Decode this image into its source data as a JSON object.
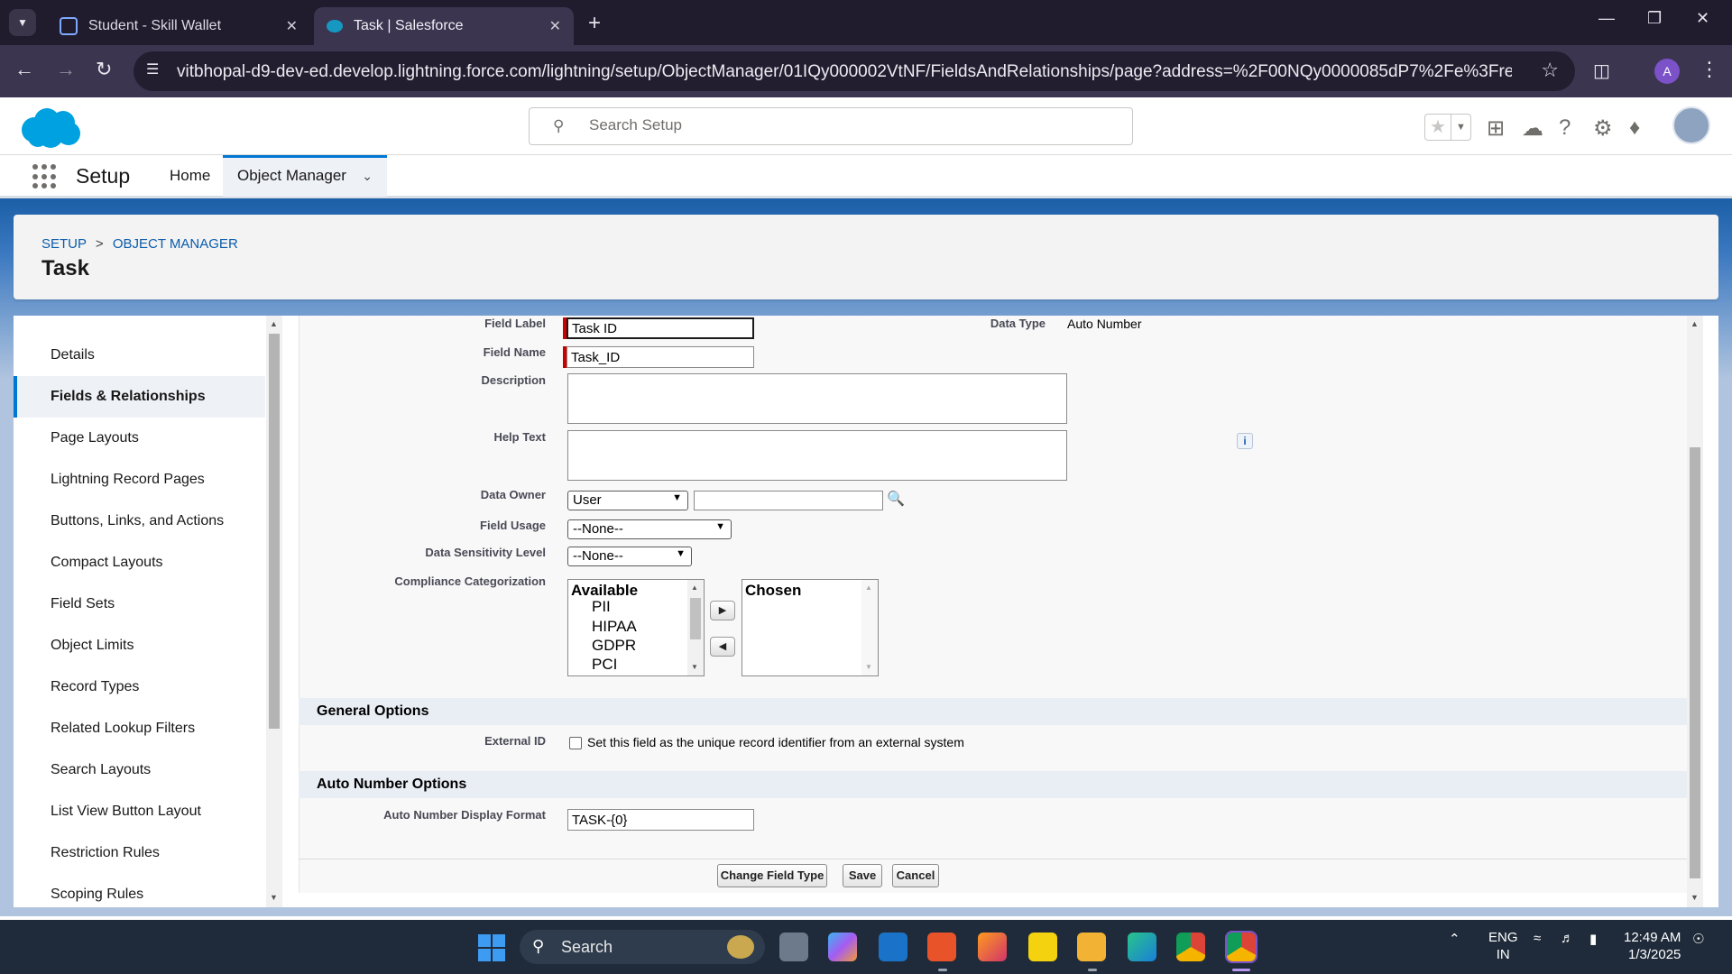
{
  "browser": {
    "tabs": [
      {
        "title": "Student - Skill Wallet"
      },
      {
        "title": "Task | Salesforce"
      }
    ],
    "url": "vitbhopal-d9-dev-ed.develop.lightning.force.com/lightning/setup/ObjectManager/01IQy000002VtNF/FieldsAndRelationships/page?address=%2F00NQy0000085dP7%2Fe%3FretURL%3D%252F...",
    "profile_initial": "A"
  },
  "header": {
    "search_placeholder": "Search Setup"
  },
  "nav": {
    "app_name": "Setup",
    "home": "Home",
    "object_manager": "Object Manager"
  },
  "page": {
    "breadcrumb_setup": "SETUP",
    "breadcrumb_sep": ">",
    "breadcrumb_om": "OBJECT MANAGER",
    "title": "Task"
  },
  "sidebar": {
    "items": [
      {
        "label": "Details"
      },
      {
        "label": "Fields & Relationships"
      },
      {
        "label": "Page Layouts"
      },
      {
        "label": "Lightning Record Pages"
      },
      {
        "label": "Buttons, Links, and Actions"
      },
      {
        "label": "Compact Layouts"
      },
      {
        "label": "Field Sets"
      },
      {
        "label": "Object Limits"
      },
      {
        "label": "Record Types"
      },
      {
        "label": "Related Lookup Filters"
      },
      {
        "label": "Search Layouts"
      },
      {
        "label": "List View Button Layout"
      },
      {
        "label": "Restriction Rules"
      },
      {
        "label": "Scoping Rules"
      }
    ],
    "active_index": 1
  },
  "form": {
    "field_label_lbl": "Field Label",
    "field_label_value": "Task ID",
    "data_type_lbl": "Data Type",
    "data_type_value": "Auto Number",
    "field_name_lbl": "Field Name",
    "field_name_value": "Task_ID",
    "description_lbl": "Description",
    "help_text_lbl": "Help Text",
    "data_owner_lbl": "Data Owner",
    "data_owner_value": "User",
    "field_usage_lbl": "Field Usage",
    "field_usage_value": "--None--",
    "sensitivity_lbl": "Data Sensitivity Level",
    "sensitivity_value": "--None--",
    "compliance_lbl": "Compliance Categorization",
    "available_hdr": "Available",
    "available_options": [
      "PII",
      "HIPAA",
      "GDPR",
      "PCI"
    ],
    "chosen_hdr": "Chosen"
  },
  "general": {
    "title": "General Options",
    "external_id_lbl": "External ID",
    "external_id_text": "Set this field as the unique record identifier from an external system",
    "external_id_checked": false
  },
  "autonum": {
    "title": "Auto Number Options",
    "format_lbl": "Auto Number Display Format",
    "format_value": "TASK-{0}"
  },
  "buttons": {
    "change_type": "Change Field Type",
    "save": "Save",
    "cancel": "Cancel"
  },
  "taskbar": {
    "search": "Search",
    "lang1": "ENG",
    "lang2": "IN",
    "time": "12:49 AM",
    "date": "1/3/2025"
  }
}
